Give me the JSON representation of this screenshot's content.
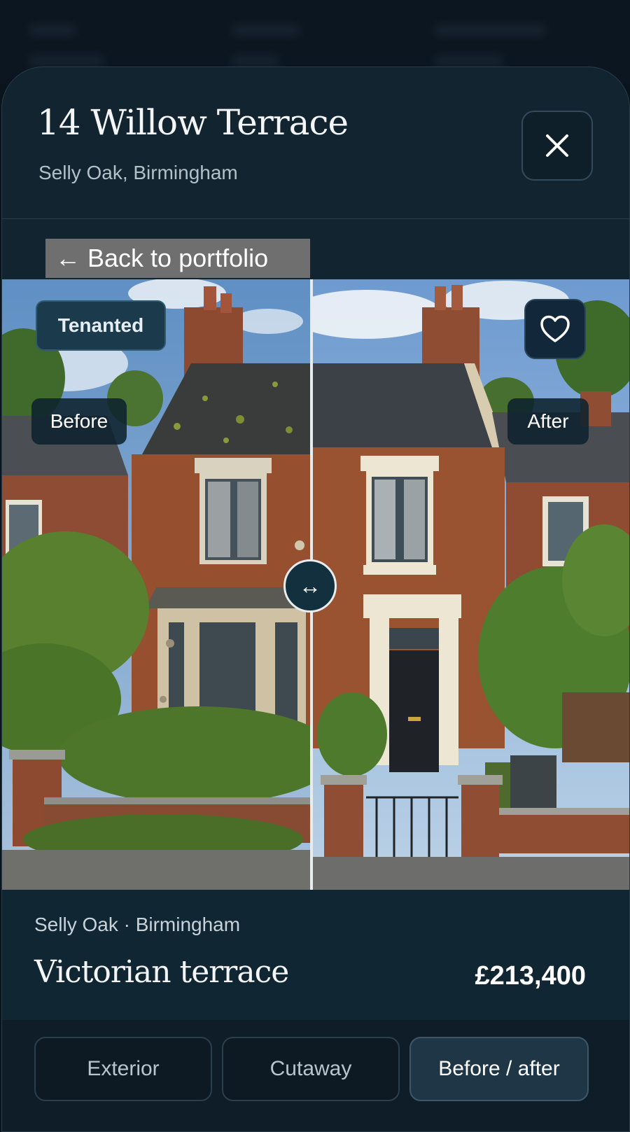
{
  "header": {
    "title": "14 Willow Terrace",
    "subtitle": "Selly Oak, Birmingham",
    "close_icon": "close-icon"
  },
  "back_link": {
    "label": "← Back to portfolio"
  },
  "compare": {
    "status_tag": "Tenanted",
    "before_label": "Before",
    "after_label": "After",
    "handle_glyph": "↔",
    "handle_icon": "arrows-horizontal-icon",
    "favorite_icon": "heart-icon",
    "slider_position": 0.5
  },
  "info": {
    "location": "Selly Oak · Birmingham",
    "property_type": "Victorian terrace",
    "price": "£213,400"
  },
  "tabs": [
    {
      "label": "Exterior",
      "active": false
    },
    {
      "label": "Cutaway",
      "active": false
    },
    {
      "label": "Before / after",
      "active": true
    }
  ],
  "colors": {
    "background": "#0a141c",
    "sheet": "#112430",
    "accent": "#1e3645"
  }
}
